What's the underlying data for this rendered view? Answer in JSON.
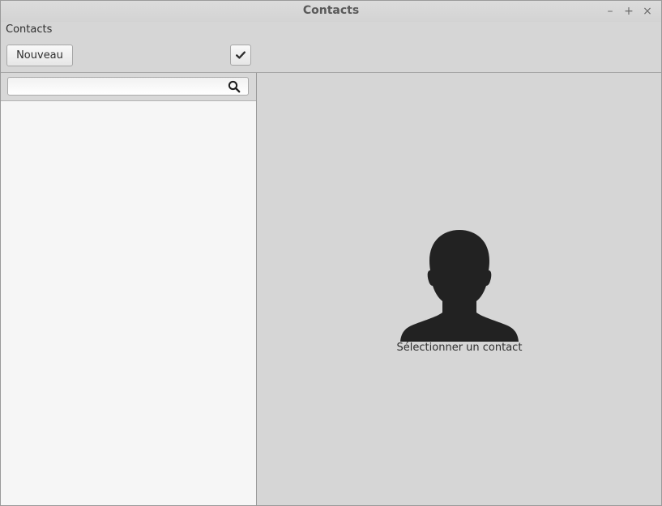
{
  "window": {
    "title": "Contacts",
    "controls": {
      "minimize": "–",
      "maximize": "+",
      "close": "×"
    }
  },
  "menubar": {
    "items": [
      {
        "label": "Contacts"
      }
    ]
  },
  "toolbar": {
    "new_label": "Nouveau",
    "check_icon": "checkmark-icon"
  },
  "search": {
    "value": "",
    "placeholder": "",
    "icon": "search-icon"
  },
  "contacts": [],
  "detail": {
    "icon": "person-silhouette-icon",
    "empty_message": "Sélectionner un contact"
  },
  "colors": {
    "window_bg": "#d6d6d6",
    "list_bg": "#f6f6f6",
    "silhouette": "#222222"
  }
}
